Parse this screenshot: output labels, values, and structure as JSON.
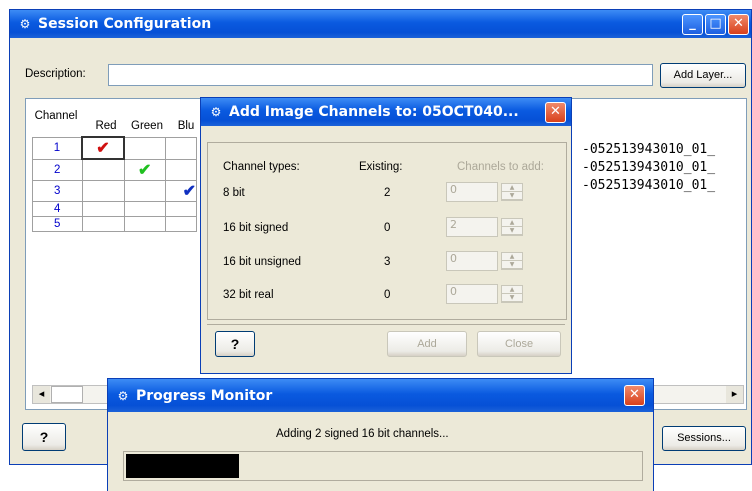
{
  "session": {
    "title": "Session Configuration",
    "description_label": "Description:",
    "description_value": "",
    "add_layer": "Add Layer...",
    "sessions": "Sessions...",
    "headers": [
      "Channel",
      "Red",
      "Green",
      "Blu"
    ],
    "rows": [
      {
        "channel": "1",
        "check": "✔",
        "file": "-052513943010_01_"
      },
      {
        "channel": "2",
        "check": "✔",
        "file": "-052513943010_01_"
      },
      {
        "channel": "3",
        "check": "✔",
        "file": "-052513943010_01_"
      },
      {
        "channel": "4",
        "check": "",
        "file": ""
      },
      {
        "channel": "5",
        "check": "",
        "file": ""
      }
    ],
    "colors": {
      "red_check": "#d01010",
      "green_check": "#20c020",
      "blue_check": "#1030c0"
    }
  },
  "add_channels": {
    "title": "Add Image Channels to: 05OCT040...",
    "col_types": "Channel types:",
    "col_existing": "Existing:",
    "col_toadd": "Channels to add:",
    "rows": [
      {
        "type": "8 bit",
        "existing": "2",
        "toadd": "0"
      },
      {
        "type": "16 bit signed",
        "existing": "0",
        "toadd": "2"
      },
      {
        "type": "16 bit unsigned",
        "existing": "3",
        "toadd": "0"
      },
      {
        "type": "32 bit real",
        "existing": "0",
        "toadd": "0"
      }
    ],
    "add": "Add",
    "close": "Close",
    "help": "?"
  },
  "progress": {
    "title": "Progress Monitor",
    "message": "Adding 2 signed 16 bit channels...",
    "fraction": 0.22
  },
  "help_glyph": "?",
  "close_glyph": "✕",
  "minimize_glyph": "_",
  "maximize_glyph": "□",
  "app_icon": "⚙",
  "scroll_left": "◂",
  "scroll_right": "▸"
}
